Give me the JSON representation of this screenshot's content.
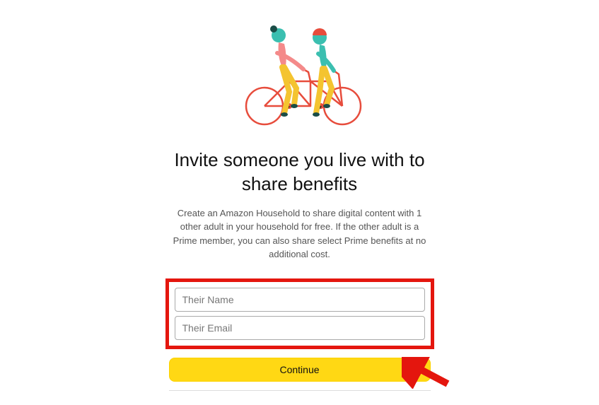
{
  "heading": "Invite someone you live with to share benefits",
  "description": "Create an Amazon Household to share digital content with 1 other adult in your household for free. If the other adult is a Prime member, you can also share select Prime benefits at no additional cost.",
  "form": {
    "name_placeholder": "Their Name",
    "email_placeholder": "Their Email",
    "name_value": "",
    "email_value": ""
  },
  "buttons": {
    "continue": "Continue"
  },
  "illustration": {
    "name": "tandem-bicycle-two-riders"
  },
  "annotations": {
    "highlight": "red-box-around-inputs",
    "arrow": "red-arrow-pointing-at-continue"
  }
}
